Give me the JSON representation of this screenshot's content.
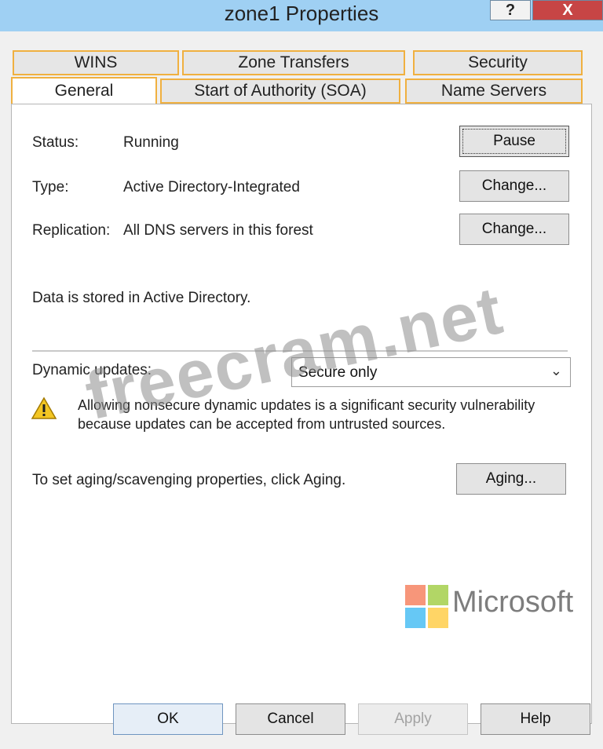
{
  "window": {
    "title": "zone1 Properties",
    "help_glyph": "?",
    "close_glyph": "X"
  },
  "tabs": {
    "row1": [
      "WINS",
      "Zone Transfers",
      "Security"
    ],
    "row2": [
      "General",
      "Start of Authority (SOA)",
      "Name Servers"
    ],
    "active": "General"
  },
  "general": {
    "status_label": "Status:",
    "status_value": "Running",
    "pause_button": "Pause",
    "type_label": "Type:",
    "type_value": "Active Directory-Integrated",
    "change_button_1": "Change...",
    "replication_label": "Replication:",
    "replication_value": "All DNS servers in this forest",
    "change_button_2": "Change...",
    "data_stored": "Data is stored in Active Directory.",
    "dynamic_updates_label": "Dynamic updates:",
    "dynamic_updates_value": "Secure only",
    "warning_text": "Allowing nonsecure dynamic updates is a significant security vulnerability because updates can be accepted from untrusted sources.",
    "aging_text": "To set aging/scavenging properties, click Aging.",
    "aging_button": "Aging..."
  },
  "footer": {
    "ok": "OK",
    "cancel": "Cancel",
    "apply": "Apply",
    "help": "Help"
  },
  "overlay": {
    "watermark": "freecram.net",
    "brand": "Microsoft"
  },
  "colors": {
    "titlebar": "#9fd0f3",
    "close_button": "#c74545",
    "tab_border": "#f0b040",
    "ms_red": "#f25022",
    "ms_green": "#7fba00",
    "ms_blue": "#00a4ef",
    "ms_yellow": "#ffb900"
  }
}
